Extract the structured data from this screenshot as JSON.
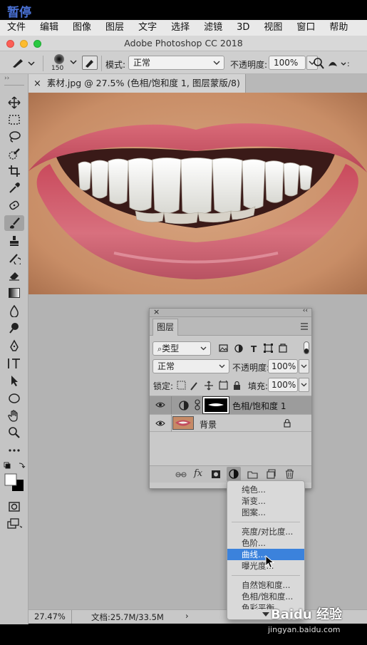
{
  "overlay": {
    "paused_label": "暂停"
  },
  "menubar": {
    "items": [
      "文件",
      "编辑",
      "图像",
      "图层",
      "文字",
      "选择",
      "滤镜",
      "3D",
      "视图",
      "窗口",
      "帮助"
    ]
  },
  "window": {
    "title": "Adobe Photoshop CC 2018"
  },
  "options": {
    "brush_size": "150",
    "mode_label": "模式:",
    "mode_value": "正常",
    "opacity_label": "不透明度:",
    "opacity_value": "100%"
  },
  "document": {
    "tab_title": "素材.jpg @ 27.5% (色相/饱和度 1, 图层蒙版/8) *",
    "zoom": "27.47%",
    "doc_size": "文档:25.7M/33.5M",
    "status_arrow": "›"
  },
  "layers_panel": {
    "tab_label": "图层",
    "filter_value": "类型",
    "blend_mode": "正常",
    "opacity_label": "不透明度:",
    "opacity_value": "100%",
    "lock_label": "锁定:",
    "fill_label": "填充:",
    "fill_value": "100%",
    "layers": [
      {
        "name": "色相/饱和度 1",
        "selected": true
      },
      {
        "name": "背景",
        "selected": false
      }
    ],
    "footer_fx": "fx"
  },
  "adjustment_menu": {
    "items": [
      {
        "label": "纯色...",
        "group": 1
      },
      {
        "label": "渐变...",
        "group": 1
      },
      {
        "label": "图案...",
        "group": 1
      },
      {
        "label": "亮度/对比度...",
        "group": 2
      },
      {
        "label": "色阶...",
        "group": 2
      },
      {
        "label": "曲线...",
        "group": 2,
        "highlighted": true
      },
      {
        "label": "曝光度...",
        "group": 2
      },
      {
        "label": "自然饱和度...",
        "group": 3
      },
      {
        "label": "色相/饱和度...",
        "group": 3
      },
      {
        "label": "色彩平衡...",
        "group": 3
      }
    ]
  },
  "watermark": {
    "brand": "Baidu 经验",
    "url": "jingyan.baidu.com"
  },
  "colors": {
    "menu_highlight": "#3b82dc",
    "paused_text": "#4b73d8"
  },
  "icons": [
    "brush-icon",
    "move-icon",
    "marquee-icon",
    "lasso-icon",
    "quick-select-icon",
    "crop-icon",
    "eyedropper-icon",
    "healing-icon",
    "stamp-icon",
    "history-brush-icon",
    "eraser-icon",
    "gradient-icon",
    "blur-icon",
    "dodge-icon",
    "pen-icon",
    "type-icon",
    "path-select-icon",
    "ellipse-icon",
    "hand-icon",
    "zoom-icon",
    "more-icon",
    "eye-icon",
    "lock-icon",
    "link-icon",
    "mask-icon",
    "adjustment-icon",
    "folder-icon",
    "new-layer-icon",
    "trash-icon",
    "search-icon"
  ]
}
